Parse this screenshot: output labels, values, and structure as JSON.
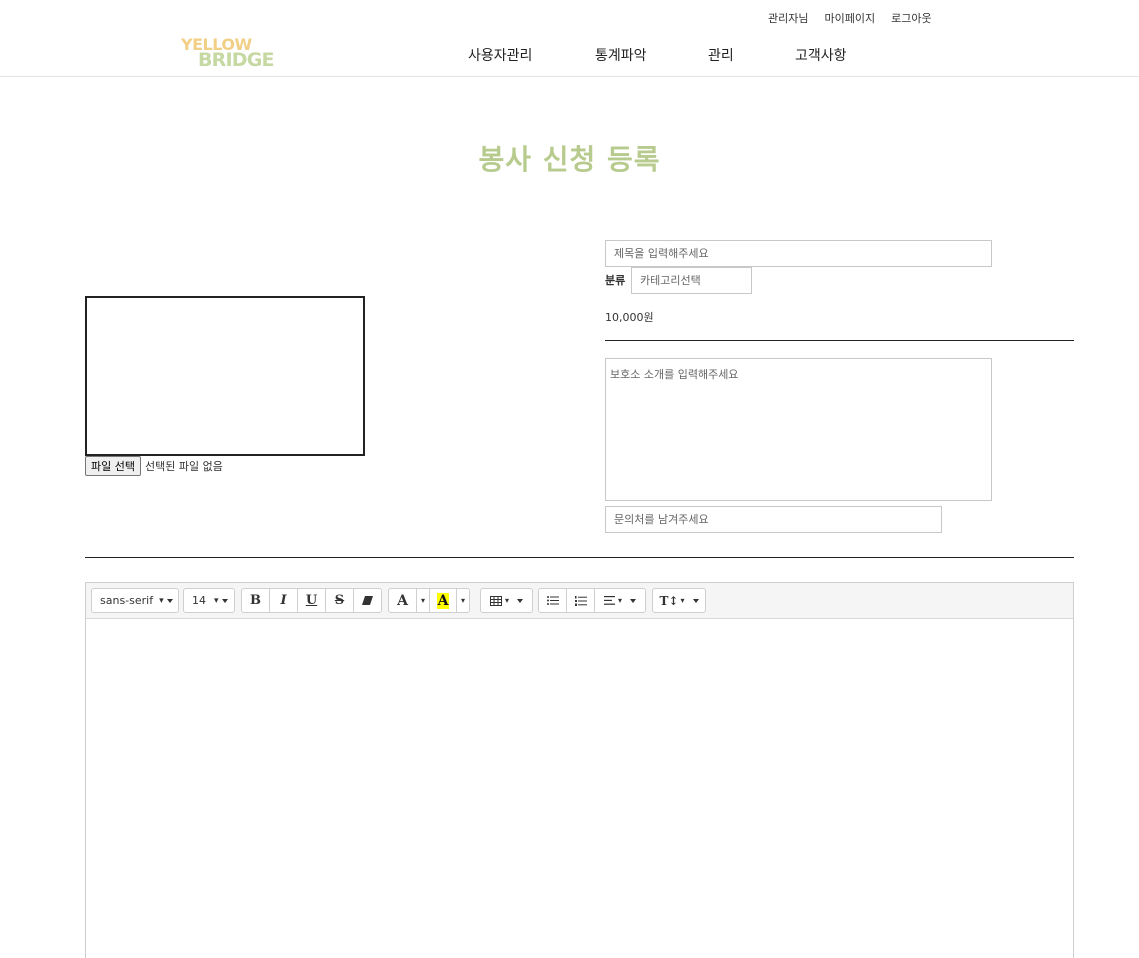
{
  "header": {
    "logo_line1": "YELLOW",
    "logo_line2": "BRIDGE",
    "top_links": [
      "관리자님",
      "마이페이지",
      "로그아웃"
    ],
    "nav": [
      "사용자관리",
      "통계파악",
      "관리",
      "고객사항"
    ]
  },
  "page": {
    "title": "봉사 신청 등록"
  },
  "image_upload": {
    "button_label": "파일 선택",
    "status": "선택된 파일 없음"
  },
  "form": {
    "title_placeholder": "제목을 입력해주세요",
    "category_label": "분류",
    "category_placeholder": "카테고리선택",
    "price": "10,000원",
    "intro_placeholder": "보호소 소개를 입력해주세요",
    "contact_placeholder": "문의처를 남겨주세요"
  },
  "editor": {
    "font_family": "sans-serif",
    "font_size": "14",
    "buttons": {
      "bold": "B",
      "italic": "I",
      "underline": "U",
      "strike": "S",
      "font_color": "A",
      "highlight": "A",
      "font_height": "T↕"
    }
  },
  "colors": {
    "title": "#b8cb8e",
    "logo_yellow": "#f1cf86",
    "logo_green": "#c7d9a3",
    "highlight": "#ffff00"
  }
}
